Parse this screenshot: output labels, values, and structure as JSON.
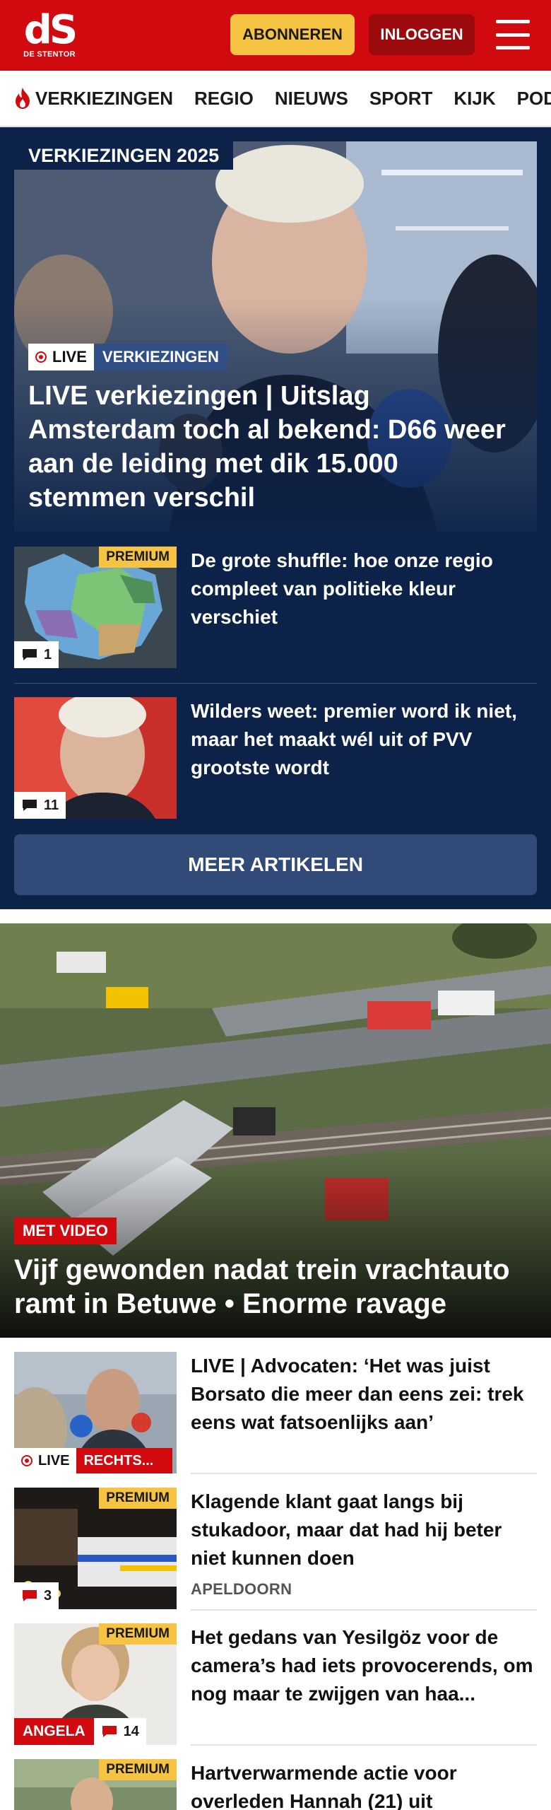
{
  "header": {
    "logo_mark": "dS",
    "logo_sub": "DE STENTOR",
    "subscribe_label": "ABONNEREN",
    "login_label": "INLOGGEN"
  },
  "nav": {
    "items": [
      {
        "label": "VERKIEZINGEN",
        "icon": "flame-icon"
      },
      {
        "label": "REGIO"
      },
      {
        "label": "NIEUWS"
      },
      {
        "label": "SPORT"
      },
      {
        "label": "KIJK"
      },
      {
        "label": "PODC"
      }
    ]
  },
  "election": {
    "label": "VERKIEZINGEN 2025",
    "hero": {
      "live_tag": "LIVE",
      "category": "VERKIEZINGEN",
      "headline": "LIVE verkiezingen | Uitslag Amsterdam toch al bekend: D66 weer aan de leiding met dik 15.000 stemmen verschil"
    },
    "articles": [
      {
        "premium": "PREMIUM",
        "comments": "1",
        "title": "De grote shuffle: hoe onze regio compleet van politieke kleur verschiet"
      },
      {
        "comments": "11",
        "title": "Wilders weet: premier word ik niet, maar het maakt wél uit of PVV grootste wordt"
      }
    ],
    "more_label": "MEER ARTIKELEN"
  },
  "hero2": {
    "tag": "MET VIDEO",
    "headline": "Vijf gewonden nadat trein vrachtauto ramt in Betuwe • Enorme ravage"
  },
  "list": [
    {
      "live_tag": "LIVE",
      "category": "RECHTS...",
      "title": "LIVE | Advocaten: ‘Het was juist Borsato die meer dan eens zei: trek eens wat fatsoenlijks aan’"
    },
    {
      "premium": "PREMIUM",
      "comments": "3",
      "title": "Klagende klant gaat langs bij stukadoor, maar dat had hij beter niet kunnen doen",
      "kicker": "APELDOORN"
    },
    {
      "premium": "PREMIUM",
      "name_tag": "ANGELA",
      "comments": "14",
      "title": "Het gedans van Yesilgöz voor de camera’s had iets provocerends, om nog maar te zwijgen van haa..."
    },
    {
      "premium": "PREMIUM",
      "title": "Hartverwarmende actie voor overleden Hannah (21) uit"
    }
  ]
}
